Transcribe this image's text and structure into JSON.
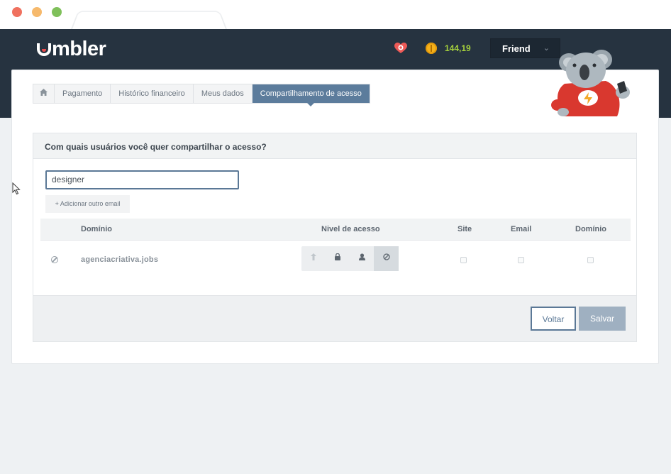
{
  "header": {
    "logo_text": "mbler",
    "credits": "144,19",
    "user_name": "Friend",
    "user_chevron": "⌄"
  },
  "breadcrumb": {
    "items": [
      "Pagamento",
      "Histórico financeiro",
      "Meus dados",
      "Compartilhamento de acesso"
    ],
    "active_index": 3
  },
  "share": {
    "title": "Com quais usuários você quer compartilhar o acesso?",
    "email_value": "designer",
    "add_email_label": "+ Adicionar outro email"
  },
  "table": {
    "headers": {
      "domain": "Domínio",
      "access_level": "Nivel de acesso",
      "site": "Site",
      "email": "Email",
      "domain2": "Domínio"
    },
    "rows": [
      {
        "domain": "agenciacriativa.jobs",
        "selected_level": "blocked",
        "site": false,
        "email": false,
        "domain_access": false
      }
    ]
  },
  "footer": {
    "back_label": "Voltar",
    "save_label": "Salvar"
  },
  "colors": {
    "topbar": "#263340",
    "accent": "#5c7c9c",
    "credits": "#a4cf3d",
    "save_disabled": "#9fb0c1"
  },
  "icons": [
    "home-icon",
    "heart-icon",
    "coin-icon",
    "chevron-down-icon",
    "block-icon",
    "upload-icon",
    "lock-icon",
    "user-icon",
    "koala-mascot",
    "cursor-icon"
  ]
}
